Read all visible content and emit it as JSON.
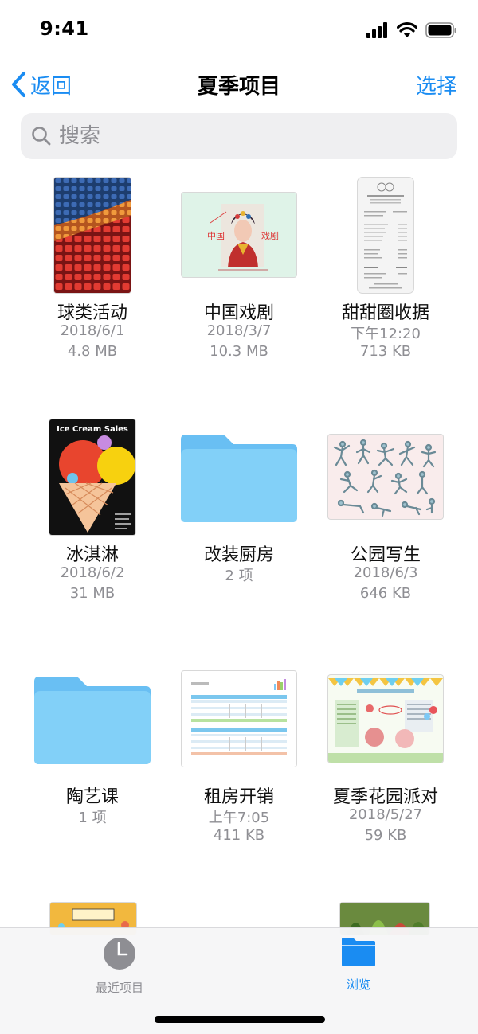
{
  "status": {
    "time": "9:41"
  },
  "nav": {
    "back_label": "返回",
    "title": "夏季项目",
    "select_label": "选择"
  },
  "search": {
    "placeholder": "搜索"
  },
  "files": [
    {
      "name": "球类活动",
      "line1": "2018/6/1",
      "line2": "4.8 MB",
      "icon": "stadium-seats-thumbnail"
    },
    {
      "name": "中国戏剧",
      "line1": "2018/3/7",
      "line2": "10.3 MB",
      "icon": "chinese-opera-thumbnail"
    },
    {
      "name": "甜甜圈收据",
      "line1": "下午12:20",
      "line2": "713 KB",
      "icon": "receipt-thumbnail"
    },
    {
      "name": "冰淇淋",
      "line1": "2018/6/2",
      "line2": "31 MB",
      "icon": "ice-cream-poster-thumbnail",
      "poster_title": "Ice Cream Sales"
    },
    {
      "name": "改装厨房",
      "line1": "2 项",
      "line2": "",
      "icon": "folder-icon"
    },
    {
      "name": "公园写生",
      "line1": "2018/6/3",
      "line2": "646 KB",
      "icon": "sketch-thumbnail"
    },
    {
      "name": "陶艺课",
      "line1": "1 项",
      "line2": "",
      "icon": "folder-icon"
    },
    {
      "name": "租房开销",
      "line1": "上午7:05",
      "line2": "411 KB",
      "icon": "spreadsheet-thumbnail"
    },
    {
      "name": "夏季花园派对",
      "line1": "2018/5/27",
      "line2": "59 KB",
      "icon": "party-document-thumbnail"
    }
  ],
  "tabs": [
    {
      "label": "最近项目",
      "icon": "clock-icon",
      "active": false
    },
    {
      "label": "浏览",
      "icon": "folder-icon",
      "active": true
    }
  ],
  "colors": {
    "accent": "#1a8cf2",
    "folder": "#7cc8f5",
    "inactive_tab": "#8e8e93"
  }
}
